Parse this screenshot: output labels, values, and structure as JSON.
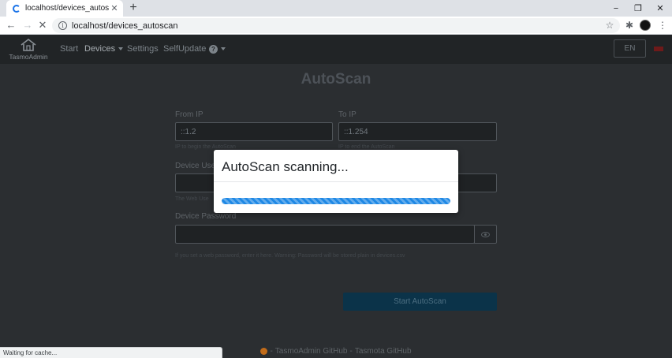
{
  "browser": {
    "tab_title": "localhost/devices_autoscan",
    "close_glyph": "✕",
    "new_tab_glyph": "+",
    "url": "localhost/devices_autoscan",
    "status_text": "Waiting for cache...",
    "window_controls": {
      "minimize": "−",
      "restore": "❐",
      "close": "✕"
    },
    "nav": {
      "back": "←",
      "forward": "→",
      "stop": "✕"
    },
    "toolbar_icons": {
      "bookmark": "☆",
      "extensions": "✱",
      "menu": "⋮"
    }
  },
  "app": {
    "brand": "TasmoAdmin",
    "nav": [
      {
        "label": "Start"
      },
      {
        "label": "Devices"
      },
      {
        "label": "Settings"
      },
      {
        "label": "SelfUpdate"
      }
    ],
    "help_glyph": "?",
    "language": "EN"
  },
  "page": {
    "title": "AutoScan",
    "form": {
      "from_ip": {
        "label": "From IP",
        "value": "::1.2",
        "hint": "IP to begin the AutoScan"
      },
      "to_ip": {
        "label": "To IP",
        "value": "::1.254",
        "hint": "IP to end the AutoScan"
      },
      "device_user": {
        "label": "Device Use",
        "value": "",
        "hint": "The Web Use"
      },
      "device_password": {
        "label": "Device Password",
        "value": "",
        "hint": "If you set a web password, enter it here. Warning: Password will be stored plain in devices.csv"
      },
      "submit_label": "Start AutoScan"
    },
    "footer": {
      "link1": "TasmoAdmin GitHub",
      "separator": "-",
      "link2": "Tasmota GitHub"
    }
  },
  "modal": {
    "title": "AutoScan scanning...",
    "progress": 1.0
  },
  "colors": {
    "progress_bar": "#1e88e5",
    "page_background": "#2b2e31",
    "navbar_background": "#212426",
    "submit_button": "#0b3349"
  }
}
